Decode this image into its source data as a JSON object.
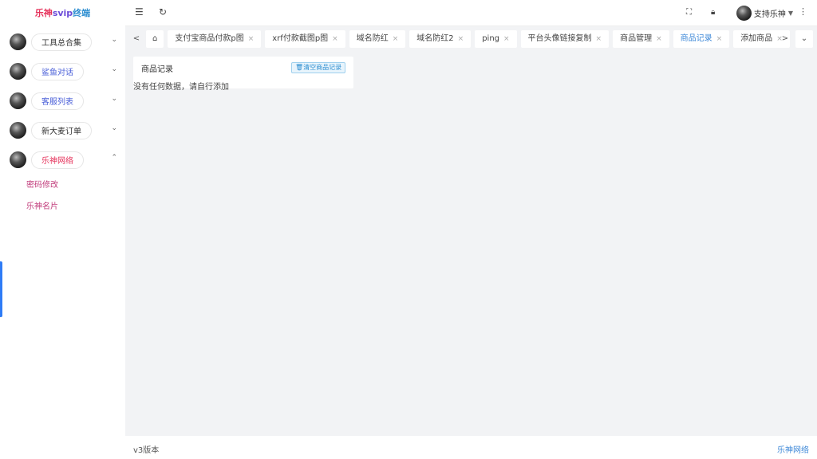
{
  "sidebar": {
    "logo_part1": "乐神",
    "logo_part2": "svip",
    "logo_part3": "终端",
    "items": [
      {
        "label": "工具总合集",
        "arrow": "⌄"
      },
      {
        "label": "鲨鱼对话",
        "arrow": "⌄"
      },
      {
        "label": "客服列表",
        "arrow": "⌄"
      },
      {
        "label": "新大麦订单",
        "arrow": "⌄"
      },
      {
        "label": "乐神网络",
        "arrow": "⌃"
      }
    ],
    "submenu": [
      "密码修改",
      "乐神名片"
    ]
  },
  "header": {
    "username": "支持乐神",
    "fold_icon": "menu-fold-icon",
    "refresh_icon": "refresh-icon"
  },
  "tabs": {
    "items": [
      {
        "label": "支付宝商品付款p图"
      },
      {
        "label": "xrf付款截图p图"
      },
      {
        "label": "域名防红"
      },
      {
        "label": "域名防红2"
      },
      {
        "label": "ping"
      },
      {
        "label": "平台头像链接复制"
      },
      {
        "label": "商品管理"
      },
      {
        "label": "商品记录"
      },
      {
        "label": "添加商品"
      }
    ],
    "active_index": 7,
    "close_glyph": "×"
  },
  "content": {
    "card_title": "商品记录",
    "clear_button": "清空商品记录",
    "empty_text": "没有任何数据，请自行添加"
  },
  "footer": {
    "version": "v3版本",
    "brand": "乐神网络"
  },
  "colors": {
    "accent": "#3f89d8",
    "logo_red": "#e5315a",
    "background": "#f2f3f5"
  }
}
